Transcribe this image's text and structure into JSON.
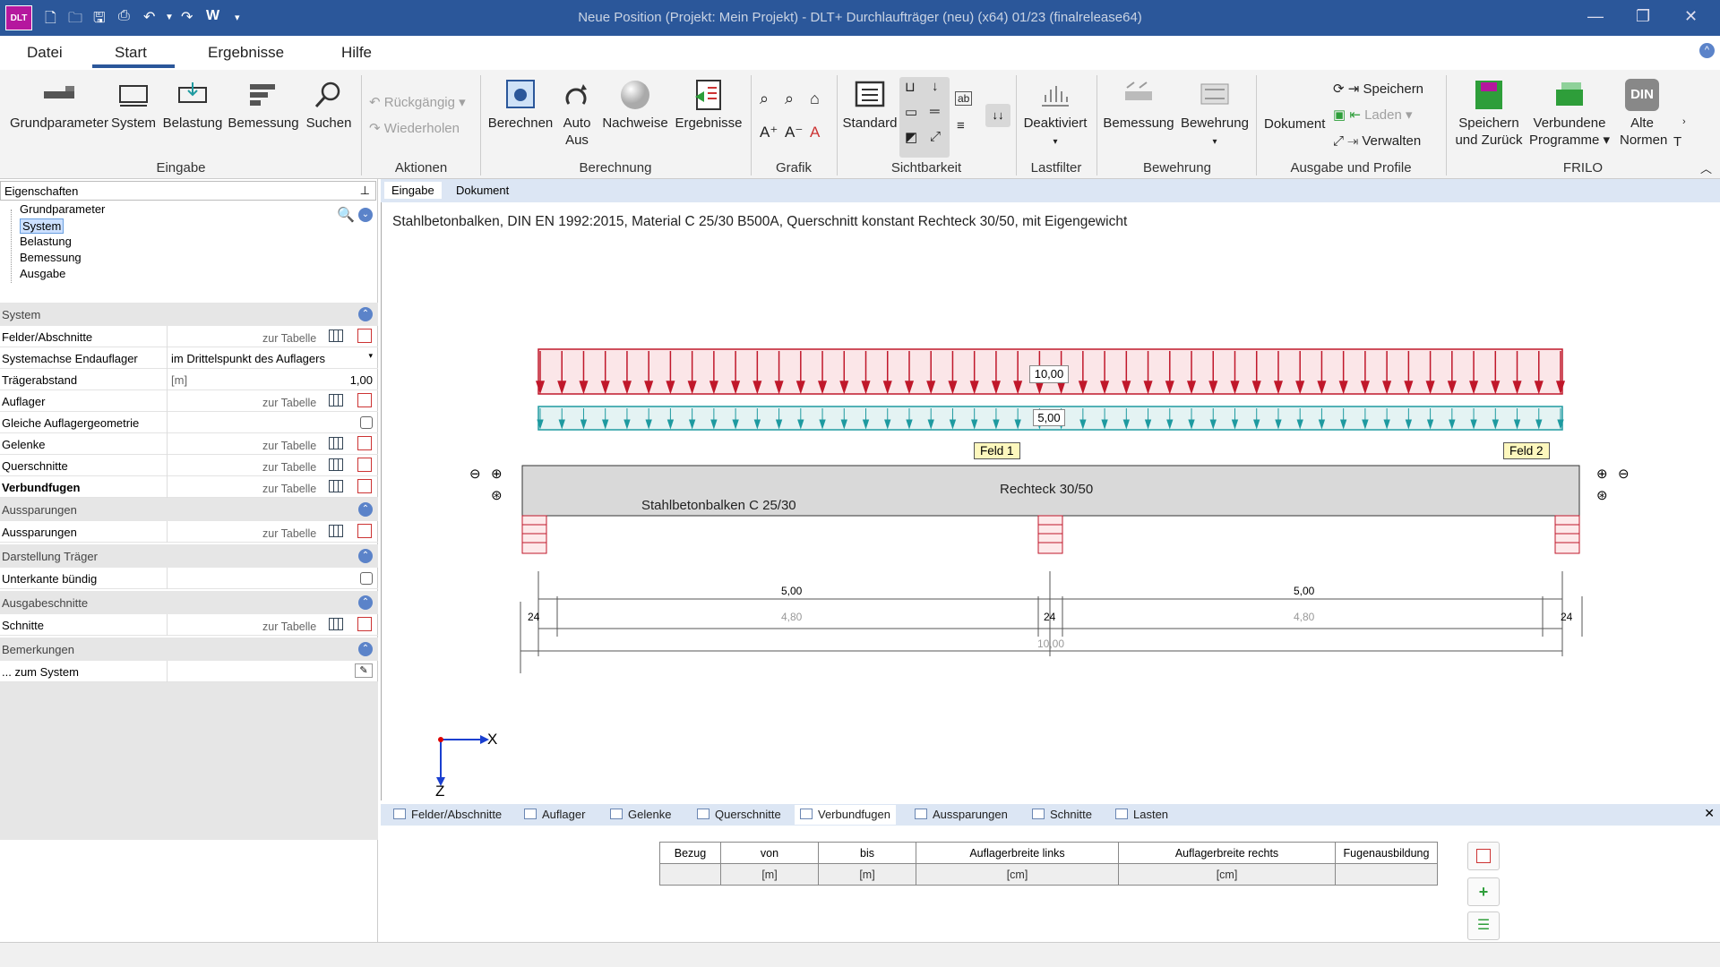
{
  "titlebar": {
    "logo": "DLT",
    "title": "Neue Position (Projekt: Mein Projekt) - DLT+ Durchlaufträger (neu) (x64) 01/23 (finalrelease64)",
    "qa_w": "W"
  },
  "tabs": {
    "datei": "Datei",
    "start": "Start",
    "ergebnisse": "Ergebnisse",
    "hilfe": "Hilfe"
  },
  "ribbon": {
    "eingabe": {
      "group": "Eingabe",
      "grundparameter": "Grundparameter",
      "system": "System",
      "belastung": "Belastung",
      "bemessung": "Bemessung",
      "suchen": "Suchen"
    },
    "aktionen": {
      "group": "Aktionen",
      "rueckgaengig": "Rückgängig",
      "wiederholen": "Wiederholen"
    },
    "berechnung": {
      "group": "Berechnung",
      "berechnen": "Berechnen",
      "auto1": "Auto",
      "auto2": "Aus",
      "nachweise": "Nachweise",
      "ergebnisse": "Ergebnisse"
    },
    "grafik": {
      "group": "Grafik"
    },
    "sichtbarkeit": {
      "group": "Sichtbarkeit",
      "standard": "Standard"
    },
    "lastfilter": {
      "group": "Lastfilter",
      "deaktiviert": "Deaktiviert"
    },
    "bewehrung": {
      "group": "Bewehrung",
      "bemessung": "Bemessung",
      "bewehrung": "Bewehrung"
    },
    "ausgabe": {
      "group": "Ausgabe und Profile",
      "dokument": "Dokument",
      "speichern": "Speichern",
      "laden": "Laden",
      "verwalten": "Verwalten"
    },
    "frilo": {
      "group": "FRILO",
      "speichern1": "Speichern",
      "speichern2": "und Zurück",
      "verbundene1": "Verbundene",
      "verbundene2": "Programme",
      "din": "DIN",
      "alte1": "Alte",
      "alte2": "Normen",
      "t": "T"
    }
  },
  "left": {
    "header": "Eigenschaften",
    "tree": [
      "Grundparameter",
      "System",
      "Belastung",
      "Bemessung",
      "Ausgabe"
    ],
    "sections": {
      "system": "System",
      "aussparungen": "Aussparungen",
      "darstellung": "Darstellung Träger",
      "ausgabeschnitte": "Ausgabeschnitte",
      "bemerkungen": "Bemerkungen"
    },
    "rows": {
      "felder": "Felder/Abschnitte",
      "systemachse": "Systemachse Endauflager",
      "systemachse_val": "im Drittelspunkt des Auflagers",
      "traegerabstand": "Trägerabstand",
      "unit_m": "[m]",
      "traegerabstand_val": "1,00",
      "auflager": "Auflager",
      "gleiche": "Gleiche Auflagergeometrie",
      "gelenke": "Gelenke",
      "querschnitte": "Querschnitte",
      "verbundfugen": "Verbundfugen",
      "aussparungen": "Aussparungen",
      "unterkante": "Unterkante bündig",
      "schnitt": "Schnitte",
      "zum_system": "... zum System",
      "zur_tabelle": "zur Tabelle"
    }
  },
  "doctabs": {
    "eingabe": "Eingabe",
    "dokument": "Dokument"
  },
  "canvas": {
    "description": "Stahlbetonbalken, DIN EN 1992:2015, Material C 25/30 B500A, Querschnitt konstant Rechteck 30/50, mit Eigengewicht",
    "load_live": "10,00",
    "load_dead": "5,00",
    "feld1": "Feld 1",
    "feld2": "Feld 2",
    "section": "Rechteck 30/50",
    "material": "Stahlbetonbalken C 25/30",
    "dims": {
      "span1": "5,00",
      "span2": "5,00",
      "clear1": "4,80",
      "clear2": "4,80",
      "total": "10,00",
      "sup1": "24",
      "sup2": "24",
      "sup3": "24"
    },
    "axis_x": "X",
    "axis_z": "Z"
  },
  "bottom_tabs": [
    "Felder/Abschnitte",
    "Auflager",
    "Gelenke",
    "Querschnitte",
    "Verbundfugen",
    "Aussparungen",
    "Schnitte",
    "Lasten"
  ],
  "table": {
    "headers": [
      "Bezug",
      "von",
      "bis",
      "Auflagerbreite links",
      "Auflagerbreite rechts",
      "Fugenausbildung"
    ],
    "units": [
      "",
      "[m]",
      "[m]",
      "[cm]",
      "[cm]",
      ""
    ]
  },
  "colors": {
    "titlebar": "#2b579a",
    "load_live": "#c0182b",
    "load_dead": "#1e9aa0"
  }
}
